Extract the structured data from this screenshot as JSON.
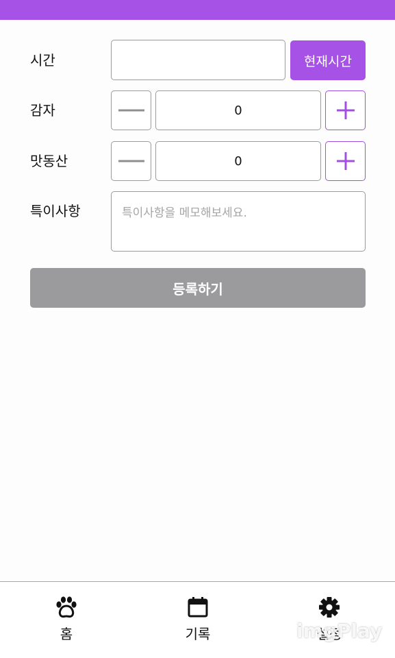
{
  "form": {
    "time": {
      "label": "시간",
      "value": "",
      "now_button": "현재시간"
    },
    "potato": {
      "label": "감자",
      "count": "0"
    },
    "sweet_potato": {
      "label": "맛동산",
      "count": "0"
    },
    "notes": {
      "label": "특이사항",
      "placeholder": "특이사항을 메모해보세요."
    },
    "submit_label": "등록하기"
  },
  "nav": {
    "items": [
      {
        "label": "홈",
        "icon": "paw-icon"
      },
      {
        "label": "기록",
        "icon": "calendar-icon"
      },
      {
        "label": "설정",
        "icon": "gear-icon"
      }
    ]
  },
  "watermark": "imgPlay",
  "colors": {
    "accent": "#a752e6",
    "submit_disabled": "#9b9a9d",
    "border": "#9a9a9a"
  }
}
